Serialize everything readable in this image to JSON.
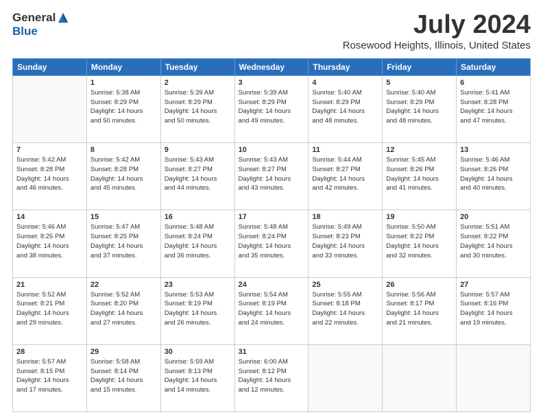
{
  "logo": {
    "general": "General",
    "blue": "Blue"
  },
  "title": "July 2024",
  "subtitle": "Rosewood Heights, Illinois, United States",
  "days_header": [
    "Sunday",
    "Monday",
    "Tuesday",
    "Wednesday",
    "Thursday",
    "Friday",
    "Saturday"
  ],
  "weeks": [
    [
      {
        "num": "",
        "info": ""
      },
      {
        "num": "1",
        "info": "Sunrise: 5:38 AM\nSunset: 8:29 PM\nDaylight: 14 hours\nand 50 minutes."
      },
      {
        "num": "2",
        "info": "Sunrise: 5:39 AM\nSunset: 8:29 PM\nDaylight: 14 hours\nand 50 minutes."
      },
      {
        "num": "3",
        "info": "Sunrise: 5:39 AM\nSunset: 8:29 PM\nDaylight: 14 hours\nand 49 minutes."
      },
      {
        "num": "4",
        "info": "Sunrise: 5:40 AM\nSunset: 8:29 PM\nDaylight: 14 hours\nand 48 minutes."
      },
      {
        "num": "5",
        "info": "Sunrise: 5:40 AM\nSunset: 8:29 PM\nDaylight: 14 hours\nand 48 minutes."
      },
      {
        "num": "6",
        "info": "Sunrise: 5:41 AM\nSunset: 8:28 PM\nDaylight: 14 hours\nand 47 minutes."
      }
    ],
    [
      {
        "num": "7",
        "info": "Sunrise: 5:42 AM\nSunset: 8:28 PM\nDaylight: 14 hours\nand 46 minutes."
      },
      {
        "num": "8",
        "info": "Sunrise: 5:42 AM\nSunset: 8:28 PM\nDaylight: 14 hours\nand 45 minutes."
      },
      {
        "num": "9",
        "info": "Sunrise: 5:43 AM\nSunset: 8:27 PM\nDaylight: 14 hours\nand 44 minutes."
      },
      {
        "num": "10",
        "info": "Sunrise: 5:43 AM\nSunset: 8:27 PM\nDaylight: 14 hours\nand 43 minutes."
      },
      {
        "num": "11",
        "info": "Sunrise: 5:44 AM\nSunset: 8:27 PM\nDaylight: 14 hours\nand 42 minutes."
      },
      {
        "num": "12",
        "info": "Sunrise: 5:45 AM\nSunset: 8:26 PM\nDaylight: 14 hours\nand 41 minutes."
      },
      {
        "num": "13",
        "info": "Sunrise: 5:46 AM\nSunset: 8:26 PM\nDaylight: 14 hours\nand 40 minutes."
      }
    ],
    [
      {
        "num": "14",
        "info": "Sunrise: 5:46 AM\nSunset: 8:25 PM\nDaylight: 14 hours\nand 38 minutes."
      },
      {
        "num": "15",
        "info": "Sunrise: 5:47 AM\nSunset: 8:25 PM\nDaylight: 14 hours\nand 37 minutes."
      },
      {
        "num": "16",
        "info": "Sunrise: 5:48 AM\nSunset: 8:24 PM\nDaylight: 14 hours\nand 36 minutes."
      },
      {
        "num": "17",
        "info": "Sunrise: 5:48 AM\nSunset: 8:24 PM\nDaylight: 14 hours\nand 35 minutes."
      },
      {
        "num": "18",
        "info": "Sunrise: 5:49 AM\nSunset: 8:23 PM\nDaylight: 14 hours\nand 33 minutes."
      },
      {
        "num": "19",
        "info": "Sunrise: 5:50 AM\nSunset: 8:22 PM\nDaylight: 14 hours\nand 32 minutes."
      },
      {
        "num": "20",
        "info": "Sunrise: 5:51 AM\nSunset: 8:22 PM\nDaylight: 14 hours\nand 30 minutes."
      }
    ],
    [
      {
        "num": "21",
        "info": "Sunrise: 5:52 AM\nSunset: 8:21 PM\nDaylight: 14 hours\nand 29 minutes."
      },
      {
        "num": "22",
        "info": "Sunrise: 5:52 AM\nSunset: 8:20 PM\nDaylight: 14 hours\nand 27 minutes."
      },
      {
        "num": "23",
        "info": "Sunrise: 5:53 AM\nSunset: 8:19 PM\nDaylight: 14 hours\nand 26 minutes."
      },
      {
        "num": "24",
        "info": "Sunrise: 5:54 AM\nSunset: 8:19 PM\nDaylight: 14 hours\nand 24 minutes."
      },
      {
        "num": "25",
        "info": "Sunrise: 5:55 AM\nSunset: 8:18 PM\nDaylight: 14 hours\nand 22 minutes."
      },
      {
        "num": "26",
        "info": "Sunrise: 5:56 AM\nSunset: 8:17 PM\nDaylight: 14 hours\nand 21 minutes."
      },
      {
        "num": "27",
        "info": "Sunrise: 5:57 AM\nSunset: 8:16 PM\nDaylight: 14 hours\nand 19 minutes."
      }
    ],
    [
      {
        "num": "28",
        "info": "Sunrise: 5:57 AM\nSunset: 8:15 PM\nDaylight: 14 hours\nand 17 minutes."
      },
      {
        "num": "29",
        "info": "Sunrise: 5:58 AM\nSunset: 8:14 PM\nDaylight: 14 hours\nand 15 minutes."
      },
      {
        "num": "30",
        "info": "Sunrise: 5:59 AM\nSunset: 8:13 PM\nDaylight: 14 hours\nand 14 minutes."
      },
      {
        "num": "31",
        "info": "Sunrise: 6:00 AM\nSunset: 8:12 PM\nDaylight: 14 hours\nand 12 minutes."
      },
      {
        "num": "",
        "info": ""
      },
      {
        "num": "",
        "info": ""
      },
      {
        "num": "",
        "info": ""
      }
    ]
  ]
}
